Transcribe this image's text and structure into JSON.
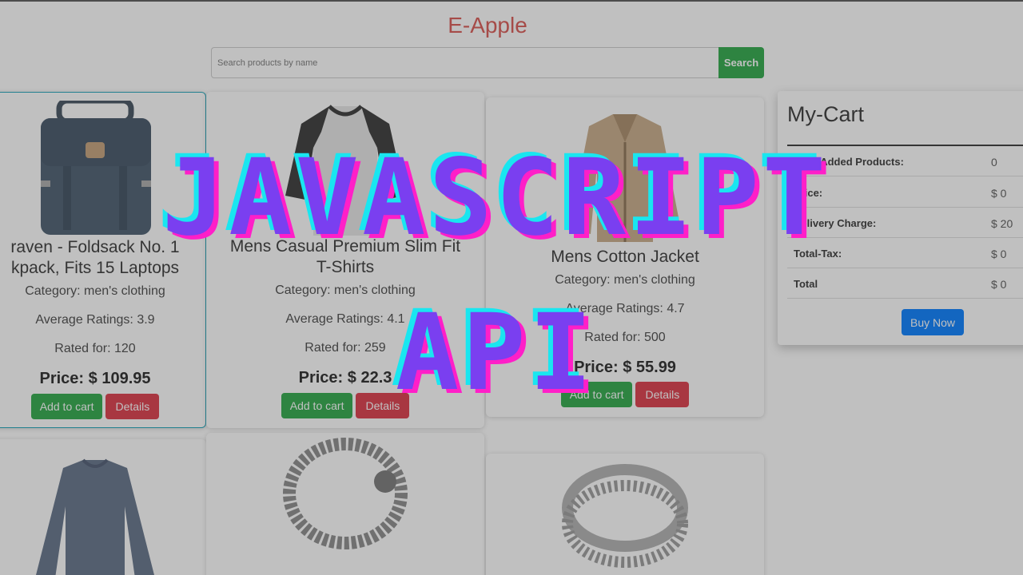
{
  "header": {
    "brand": "E-Apple"
  },
  "search": {
    "placeholder": "Search products by name",
    "button_label": "Search"
  },
  "products": [
    {
      "title_line1": "raven - Foldsack No. 1",
      "title_line2": "kpack, Fits 15 Laptops",
      "category": "Category: men's clothing",
      "ratings": "Average Ratings: 3.9",
      "rated_for": "Rated for: 120",
      "price": "Price: $ 109.95",
      "add_label": "Add to cart",
      "details_label": "Details"
    },
    {
      "title_line1": "Mens Casual Premium Slim Fit",
      "title_line2": "T-Shirts",
      "category": "Category: men's clothing",
      "ratings": "Average Ratings: 4.1",
      "rated_for": "Rated for: 259",
      "price": "Price: $ 22.3",
      "add_label": "Add to cart",
      "details_label": "Details"
    },
    {
      "title_line1": "Mens Cotton Jacket",
      "category": "Category: men's clothing",
      "ratings": "Average Ratings: 4.7",
      "rated_for": "Rated for: 500",
      "price": "Price: $ 55.99",
      "add_label": "Add to cart",
      "details_label": "Details"
    }
  ],
  "cart": {
    "title": "My-Cart",
    "rows": [
      {
        "label": "Total Added Products:",
        "value": "0"
      },
      {
        "label": "Price:",
        "value": "$ 0"
      },
      {
        "label": "Delivery Charge:",
        "value": "$ 20"
      },
      {
        "label": "Total-Tax:",
        "value": "$ 0"
      },
      {
        "label": "Total",
        "value": "$ 0"
      }
    ],
    "buy_label": "Buy Now"
  },
  "banner": {
    "line1": "JAVASCRIPT",
    "line2": "API"
  },
  "colors": {
    "brand": "#d9534f",
    "success": "#28a745",
    "danger": "#dc3545",
    "primary": "#007bff",
    "banner_fill": "#7a3ff0",
    "banner_cyan": "#19e6f0",
    "banner_pink": "#ff1fc8"
  }
}
